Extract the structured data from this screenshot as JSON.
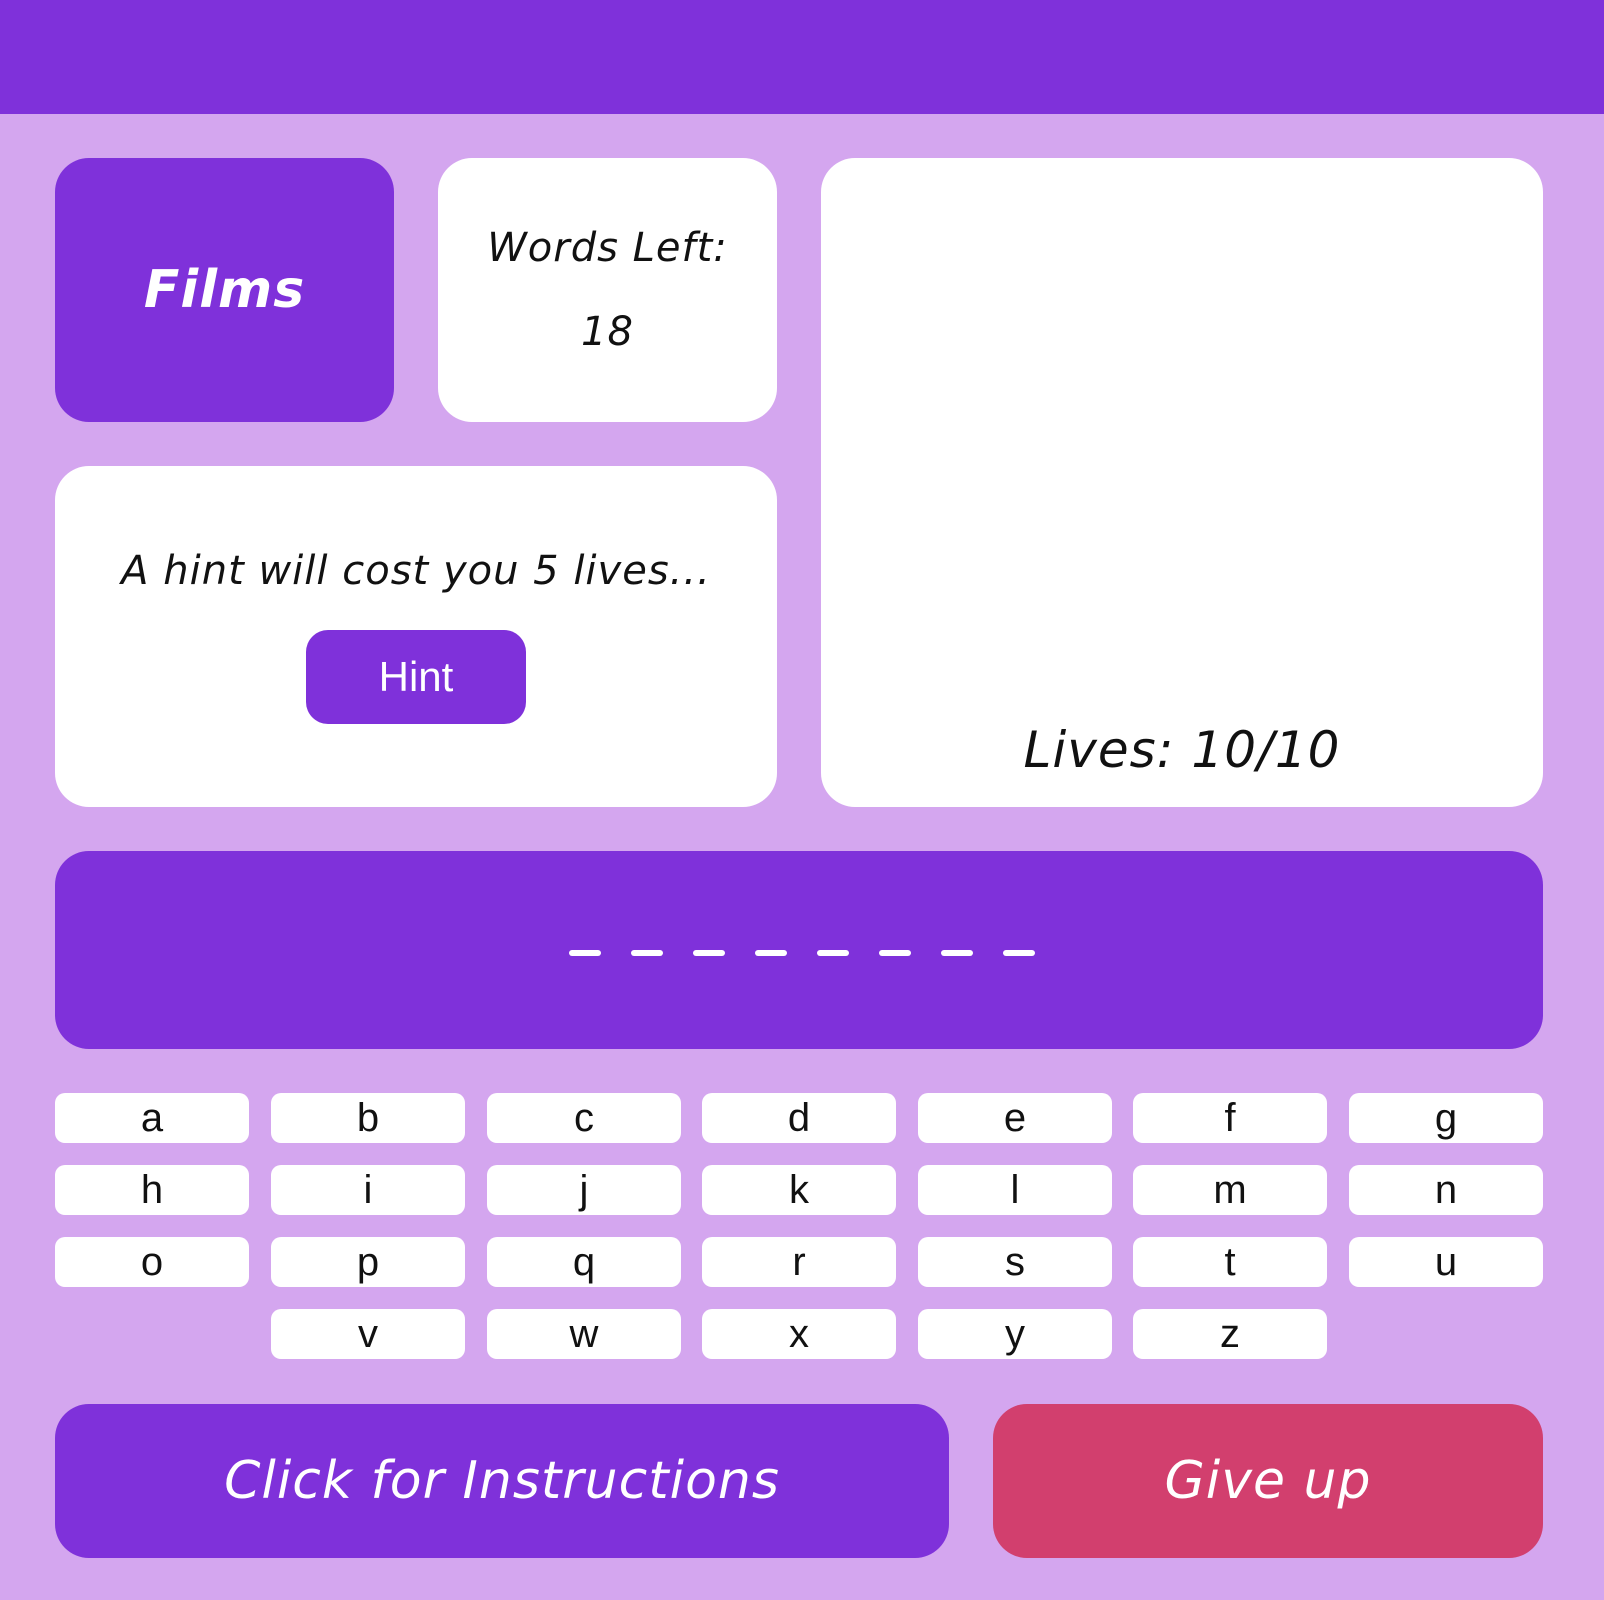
{
  "category": "Films",
  "words_left": {
    "label": "Words Left:",
    "count": "18"
  },
  "hint": {
    "text": "A hint will cost you 5 lives...",
    "button_label": "Hint"
  },
  "lives": {
    "label": "Lives: 10/10",
    "current": 10,
    "max": 10
  },
  "word": {
    "length": 8,
    "revealed": [
      "",
      "",
      "",
      "",
      "",
      "",
      "",
      ""
    ]
  },
  "keyboard": {
    "rows": [
      [
        "a",
        "b",
        "c",
        "d",
        "e",
        "f",
        "g"
      ],
      [
        "h",
        "i",
        "j",
        "k",
        "l",
        "m",
        "n"
      ],
      [
        "o",
        "p",
        "q",
        "r",
        "s",
        "t",
        "u"
      ],
      [
        "v",
        "w",
        "x",
        "y",
        "z"
      ]
    ]
  },
  "actions": {
    "instructions_label": "Click for Instructions",
    "give_up_label": "Give up"
  },
  "colors": {
    "background": "#d4a6ef",
    "primary": "#7f31da",
    "danger": "#d23f6e",
    "card": "#ffffff"
  }
}
